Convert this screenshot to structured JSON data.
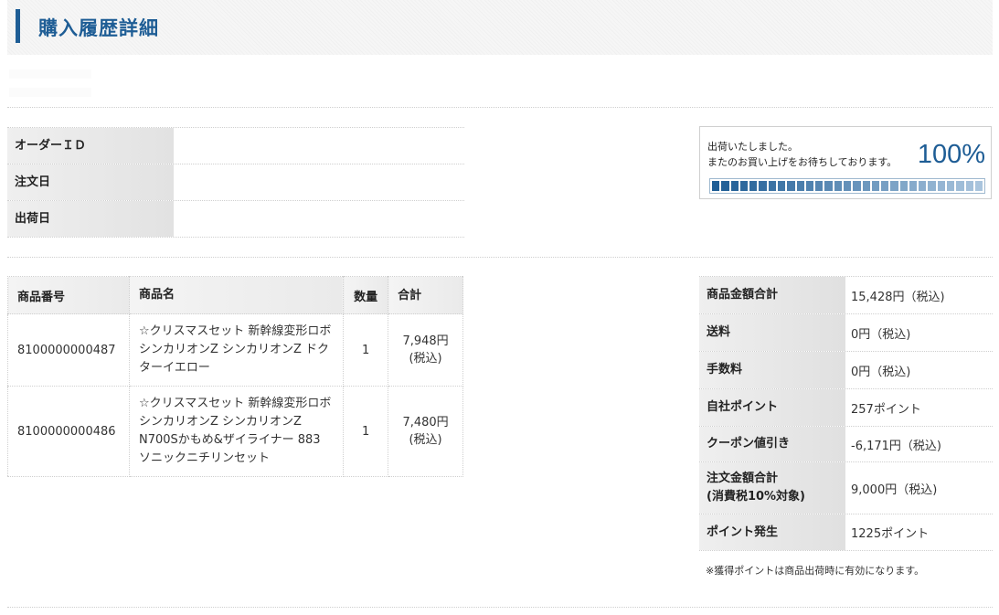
{
  "page": {
    "title": "購入履歴詳細"
  },
  "order_info": {
    "rows": [
      {
        "label": "オーダーＩＤ",
        "value": ""
      },
      {
        "label": "注文日",
        "value": ""
      },
      {
        "label": "出荷日",
        "value": ""
      }
    ]
  },
  "status": {
    "line1": "出荷いたしました。",
    "line2": "またのお買い上げをお待ちしております。",
    "percent_label": "100%",
    "progress": 1.0,
    "segments": 29,
    "color_start": "#1e5d95",
    "color_end": "#a9c4dd"
  },
  "products": {
    "headers": {
      "number": "商品番号",
      "name": "商品名",
      "qty": "数量",
      "total": "合計"
    },
    "rows": [
      {
        "number": "8100000000487",
        "name": "☆クリスマスセット 新幹線変形ロボ シンカリオンZ シンカリオンZ ドクターイエロー",
        "qty": "1",
        "price": "7,948円",
        "tax": "(税込)"
      },
      {
        "number": "8100000000486",
        "name": "☆クリスマスセット 新幹線変形ロボ シンカリオンZ シンカリオンZ N700Sかもめ&ザイライナー 883 ソニックニチリンセット",
        "qty": "1",
        "price": "7,480円",
        "tax": "(税込)"
      }
    ]
  },
  "summary": {
    "rows": [
      {
        "label": "商品金額合計",
        "value": "15,428円（税込)"
      },
      {
        "label": "送料",
        "value": "0円（税込)"
      },
      {
        "label": "手数料",
        "value": "0円（税込)"
      },
      {
        "label": "自社ポイント",
        "value": "257ポイント"
      },
      {
        "label": "クーポン値引き",
        "value": "-6,171円（税込)"
      },
      {
        "label": "注文金額合計\n(消費税10%対象)",
        "value": "9,000円（税込)"
      },
      {
        "label": "ポイント発生",
        "value": "1225ポイント"
      }
    ],
    "note": "※獲得ポイントは商品出荷時に有効になります。"
  }
}
